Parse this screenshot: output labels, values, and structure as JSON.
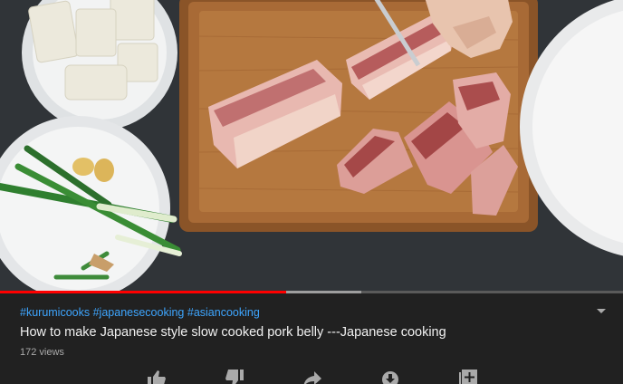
{
  "video": {
    "progress_played": 0.46,
    "progress_buffered": 0.58
  },
  "details": {
    "hashtags": [
      "#kurumicooks",
      "#japanesecooking",
      "#asiancooking"
    ],
    "title": "How to make Japanese style slow cooked pork belly ---Japanese cooking",
    "views": "172 views"
  },
  "actions": {
    "icons": [
      "thumbs-up-icon",
      "thumbs-down-icon",
      "share-icon",
      "download-icon",
      "add-to-playlist-icon"
    ]
  },
  "colors": {
    "accent_red": "#ff0000",
    "hashtag_blue": "#3ea6ff",
    "background": "#212121",
    "title_text": "#f1f1f1",
    "secondary_text": "#aaaaaa"
  }
}
